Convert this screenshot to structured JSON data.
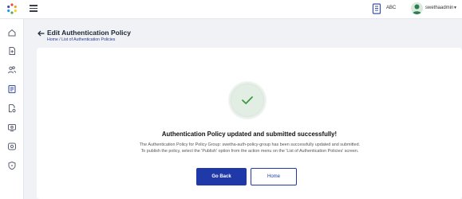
{
  "header": {
    "org_name": "ABC",
    "user_name": "swethaadmin",
    "caret": "▼"
  },
  "page": {
    "title": "Edit Authentication Policy",
    "breadcrumb_home": "Home",
    "breadcrumb_sep": " / ",
    "breadcrumb_current": "List of Authentication Policies"
  },
  "result": {
    "title": "Authentication Policy updated and submitted successfully!",
    "message": "The Authentication Policy for Policy Group: swetha-auth-policy-group has been successfully updated and submitted. To publish the policy, select the 'Publish' option from the action menu on the 'List of Authentication Policies' screen.",
    "go_back_label": "Go Back",
    "home_label": "Home"
  },
  "colors": {
    "primary": "#1f3aa8",
    "success": "#3f9a46"
  },
  "sidebar": {
    "icons": [
      "home-icon",
      "document-add-icon",
      "users-icon",
      "policy-list-icon",
      "document-settings-icon",
      "monitor-icon",
      "key-icon",
      "shield-icon"
    ],
    "active": "policy-list-icon"
  }
}
